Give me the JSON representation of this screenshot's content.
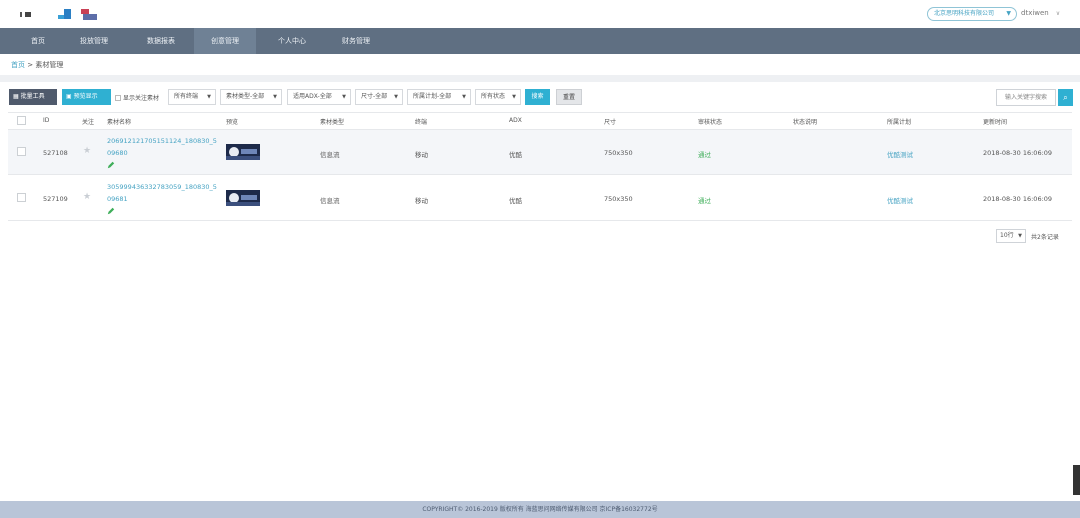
{
  "header": {
    "company_selector": "北京思明科技有限公司",
    "username": "dtxiwen"
  },
  "nav": {
    "items": [
      "首页",
      "投放管理",
      "数据报表",
      "创意管理",
      "个人中心",
      "财务管理"
    ],
    "active_index": 3
  },
  "breadcrumb": {
    "home": "首页",
    "separator": ">",
    "current": "素材管理"
  },
  "toolbar": {
    "batch_tools": "批量工具",
    "preview": "预览显示",
    "show_followed": "显示关注素材",
    "filters": [
      "所有终端",
      "素材类型-全部",
      "适用ADX-全部",
      "尺寸-全部",
      "所属计划-全部",
      "所有状态"
    ],
    "search": "搜索",
    "reset": "重置",
    "keyword_placeholder": "输入关键字搜索"
  },
  "table": {
    "columns": [
      "ID",
      "关注",
      "素材名称",
      "预览",
      "素材类型",
      "终端",
      "ADX",
      "尺寸",
      "审核状态",
      "状态说明",
      "所属计划",
      "更新时间"
    ],
    "rows": [
      {
        "id": "527108",
        "name": "206912121705151124_180830_509680",
        "type": "信息流",
        "terminal": "移动",
        "adx": "优酷",
        "size": "750x350",
        "audit": "通过",
        "status_note": "",
        "plan": "优酷测试",
        "updated": "2018-08-30 16:06:09"
      },
      {
        "id": "527109",
        "name": "305999436332783059_180830_509681",
        "type": "信息流",
        "terminal": "移动",
        "adx": "优酷",
        "size": "750x350",
        "audit": "通过",
        "status_note": "",
        "plan": "优酷测试",
        "updated": "2018-08-30 16:06:09"
      }
    ]
  },
  "pagination": {
    "page_size": "10行",
    "total": "共2条记录"
  },
  "footer": {
    "copyright": "COPYRIGHT© 2016-2019 版权所有 海蓝思问网络传媒有限公司 京ICP备16032772号"
  },
  "colors": {
    "nav_bg": "#5f6f82",
    "accent": "#2fb0d2",
    "link": "#46a3c3",
    "approved": "#3fae5a",
    "footer_bg": "#b9c5d8"
  }
}
